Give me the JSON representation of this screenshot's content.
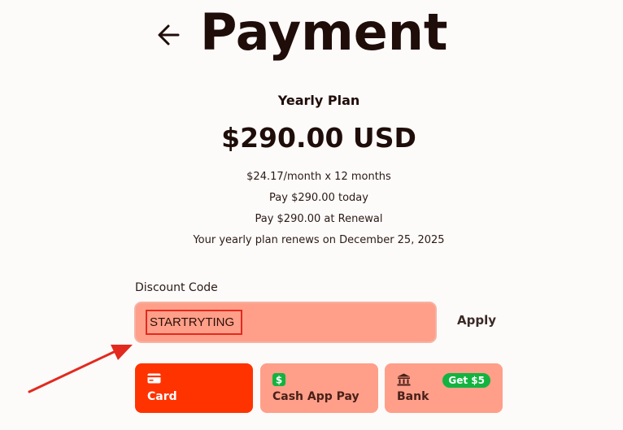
{
  "header": {
    "title": "Payment",
    "back_icon": "arrow-left-icon"
  },
  "plan": {
    "name": "Yearly Plan",
    "price": "$290.00 USD",
    "details": [
      "$24.17/month x 12 months",
      "Pay $290.00 today",
      "Pay $290.00 at Renewal",
      "Your yearly plan renews on December 25, 2025"
    ]
  },
  "discount": {
    "label": "Discount Code",
    "value": "STARTRYTING",
    "apply_label": "Apply"
  },
  "payment_methods": [
    {
      "label": "Card",
      "icon": "credit-card-icon",
      "selected": true
    },
    {
      "label": "Cash App Pay",
      "icon": "cash-app-icon",
      "selected": false
    },
    {
      "label": "Bank",
      "icon": "bank-icon",
      "selected": false,
      "badge": "Get $5"
    }
  ],
  "colors": {
    "selected_method": "#ff3300",
    "method_bg": "#ff9f89",
    "badge": "#13b340",
    "annotation": "#e22a1e"
  }
}
